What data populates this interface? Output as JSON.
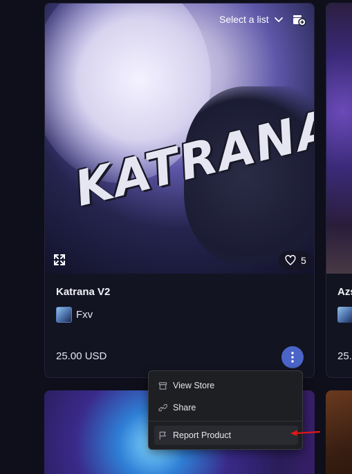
{
  "product": {
    "title": "Katrana V2",
    "creator": "Fxv",
    "price": "25.00 USD",
    "likes": "5",
    "image_logo_text": "KATRANA"
  },
  "toolbar": {
    "select_list": "Select a list"
  },
  "menu": {
    "items": [
      {
        "label": "View Store",
        "icon": "store-icon"
      },
      {
        "label": "Share",
        "icon": "link-icon"
      },
      {
        "label": "Report Product",
        "icon": "flag-icon"
      }
    ]
  },
  "neighbor": {
    "title": "Azs",
    "price": "25."
  },
  "colors": {
    "accent": "#4a64c8",
    "annotation_arrow": "#e01818"
  }
}
